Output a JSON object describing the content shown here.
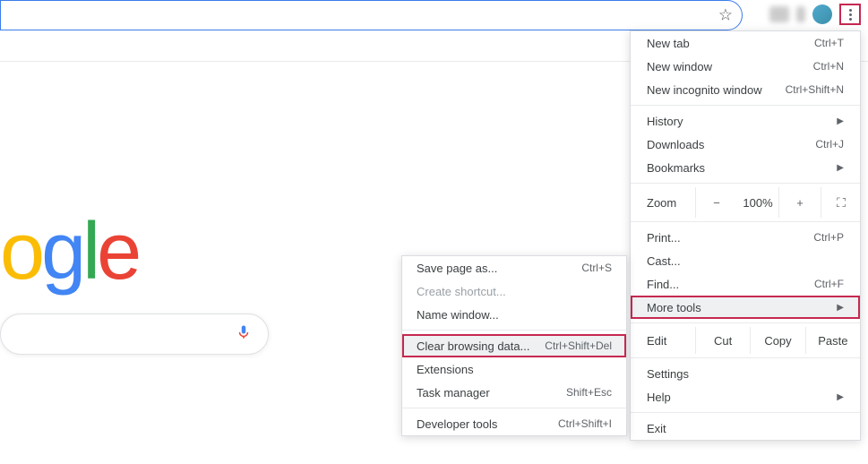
{
  "logo": {
    "o1": "o",
    "g2": "g",
    "l": "l",
    "e": "e"
  },
  "menu": {
    "new_tab": "New tab",
    "new_tab_sc": "Ctrl+T",
    "new_window": "New window",
    "new_window_sc": "Ctrl+N",
    "incognito": "New incognito window",
    "incognito_sc": "Ctrl+Shift+N",
    "history": "History",
    "downloads": "Downloads",
    "downloads_sc": "Ctrl+J",
    "bookmarks": "Bookmarks",
    "zoom_label": "Zoom",
    "zoom_minus": "−",
    "zoom_value": "100%",
    "zoom_plus": "+",
    "print": "Print...",
    "print_sc": "Ctrl+P",
    "cast": "Cast...",
    "find": "Find...",
    "find_sc": "Ctrl+F",
    "more_tools": "More tools",
    "edit_label": "Edit",
    "cut": "Cut",
    "copy": "Copy",
    "paste": "Paste",
    "settings": "Settings",
    "help": "Help",
    "exit": "Exit"
  },
  "submenu": {
    "save_page": "Save page as...",
    "save_page_sc": "Ctrl+S",
    "create_shortcut": "Create shortcut...",
    "name_window": "Name window...",
    "clear_data": "Clear browsing data...",
    "clear_data_sc": "Ctrl+Shift+Del",
    "extensions": "Extensions",
    "task_manager": "Task manager",
    "task_manager_sc": "Shift+Esc",
    "dev_tools": "Developer tools",
    "dev_tools_sc": "Ctrl+Shift+I"
  },
  "highlight_color": "#c62850"
}
